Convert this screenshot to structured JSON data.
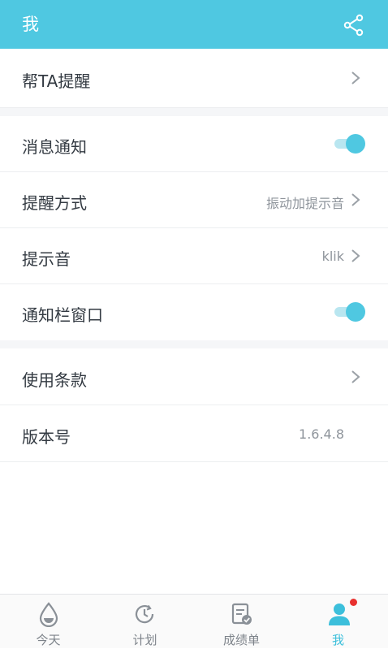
{
  "header": {
    "title": "我"
  },
  "sections": [
    {
      "label": "帮TA提醒"
    },
    {
      "label": "消息通知",
      "toggle_on": true
    },
    {
      "label": "提醒方式",
      "value": "振动加提示音"
    },
    {
      "label": "提示音",
      "value": "klik"
    },
    {
      "label": "通知栏窗口",
      "toggle_on": true
    },
    {
      "label": "使用条款"
    },
    {
      "label": "版本号",
      "value": "1.6.4.8"
    }
  ],
  "tabs": [
    {
      "label": "今天",
      "icon": "water-drop-icon"
    },
    {
      "label": "计划",
      "icon": "clock-icon"
    },
    {
      "label": "成绩单",
      "icon": "report-icon"
    },
    {
      "label": "我",
      "icon": "person-icon",
      "active": true
    }
  ],
  "colors": {
    "accent": "#4fc8e1",
    "badge": "#e8312f"
  }
}
